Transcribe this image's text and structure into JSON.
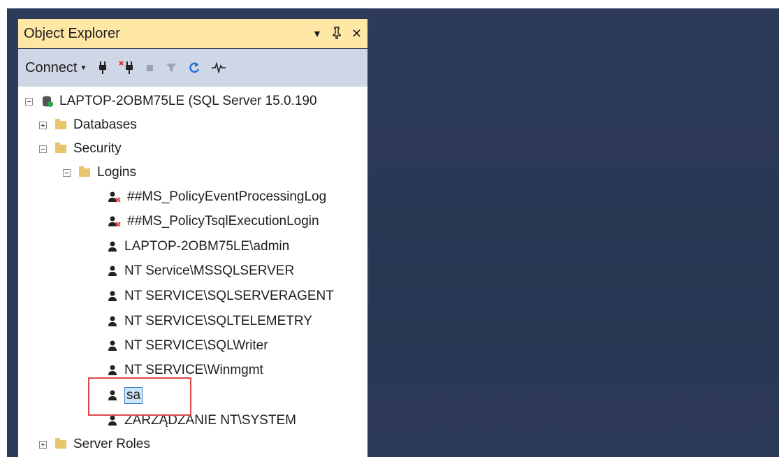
{
  "explorer": {
    "title": "Object Explorer",
    "controls": {
      "dropdown": "▾",
      "pin": "ᵽ",
      "close": "✕"
    }
  },
  "toolbar": {
    "connect_label": "Connect"
  },
  "tree": {
    "server": "LAPTOP-2OBM75LE (SQL Server 15.0.190",
    "databases": "Databases",
    "security": "Security",
    "logins": "Logins",
    "login_items": [
      "##MS_PolicyEventProcessingLog",
      "##MS_PolicyTsqlExecutionLogin",
      "LAPTOP-2OBM75LE\\admin",
      "NT Service\\MSSQLSERVER",
      "NT SERVICE\\SQLSERVERAGENT",
      "NT SERVICE\\SQLTELEMETRY",
      "NT SERVICE\\SQLWriter",
      "NT SERVICE\\Winmgmt",
      "sa",
      "ZARZĄDZANIE NT\\SYSTEM"
    ],
    "server_roles": "Server Roles"
  },
  "colors": {
    "title_bar": "#ffe8a6",
    "toolbar": "#cfd6e5",
    "background": "#2b3a58",
    "highlight": "#e04848",
    "selection": "#cde4f7"
  }
}
